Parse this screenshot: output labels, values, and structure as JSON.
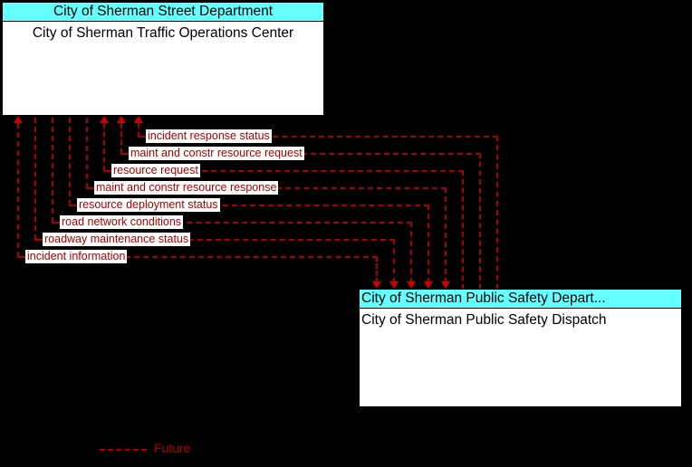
{
  "diagram": {
    "type": "interconnect",
    "background_color": "#000000",
    "flow_color": "#aa0000",
    "title_bar_color": "#66ffff"
  },
  "elements": [
    {
      "id": "tmc",
      "stakeholder": "City of Sherman Street Department",
      "name": "City of Sherman Traffic Operations Center"
    },
    {
      "id": "psd",
      "stakeholder": "City of Sherman Public Safety Depart...",
      "name": "City of Sherman Public Safety Dispatch"
    }
  ],
  "flows": [
    {
      "label": "incident response status",
      "direction": "to-tmc"
    },
    {
      "label": "maint and constr resource request",
      "direction": "to-tmc"
    },
    {
      "label": "resource request",
      "direction": "to-tmc"
    },
    {
      "label": "maint and constr resource response",
      "direction": "to-psd"
    },
    {
      "label": "resource deployment status",
      "direction": "to-psd"
    },
    {
      "label": "road network conditions",
      "direction": "to-psd"
    },
    {
      "label": "roadway maintenance status",
      "direction": "to-psd"
    },
    {
      "label": "incident information",
      "direction": "to-psd"
    }
  ],
  "legend": {
    "future_label": "Future",
    "future_color": "#aa0000"
  }
}
